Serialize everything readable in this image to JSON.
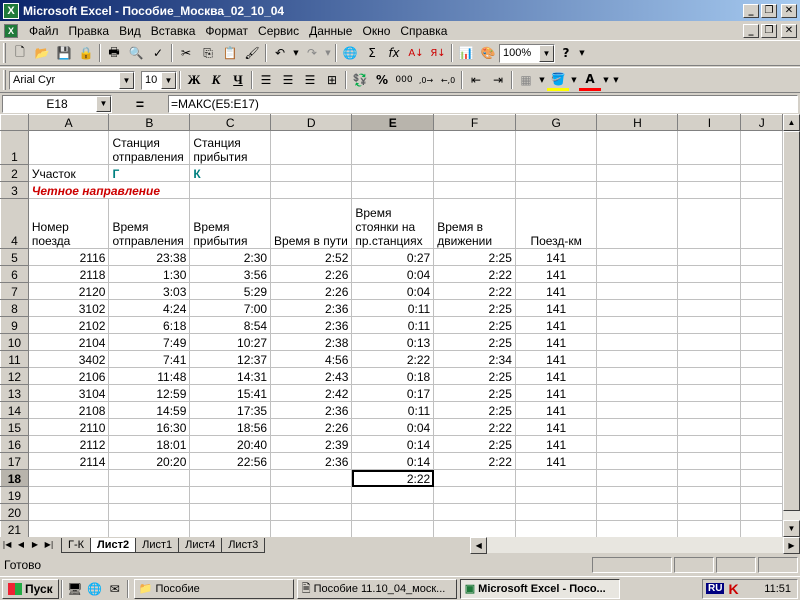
{
  "window": {
    "title": "Microsoft Excel - Пособие_Москва_02_10_04",
    "app_icon_letter": "X"
  },
  "menu": [
    "Файл",
    "Правка",
    "Вид",
    "Вставка",
    "Формат",
    "Сервис",
    "Данные",
    "Окно",
    "Справка"
  ],
  "toolbar": {
    "zoom": "100%",
    "font_name": "Arial Cyr",
    "font_size": "10",
    "bold": "Ж",
    "italic": "К",
    "underline": "Ч"
  },
  "formula_bar": {
    "cell_ref": "E18",
    "equals": "=",
    "formula": "=МАКС(E5:E17)"
  },
  "columns": [
    "A",
    "B",
    "C",
    "D",
    "E",
    "F",
    "G",
    "H",
    "I",
    "J"
  ],
  "cells": {
    "b1": "Станция отправления",
    "c1": "Станция прибытия",
    "a2": "Участок",
    "b2": "Г",
    "c2": "К",
    "a3": "Четное направление",
    "a4": "Номер поезда",
    "b4": "Время отправления",
    "c4": "Время прибытия",
    "d4": "Время в пути",
    "e4": "Время стоянки на пр.станциях",
    "f4": "Время в движении",
    "g4": "Поезд-км",
    "e18": "2:22"
  },
  "rows": [
    [
      "2116",
      "23:38",
      "2:30",
      "2:52",
      "0:27",
      "2:25",
      "141"
    ],
    [
      "2118",
      "1:30",
      "3:56",
      "2:26",
      "0:04",
      "2:22",
      "141"
    ],
    [
      "2120",
      "3:03",
      "5:29",
      "2:26",
      "0:04",
      "2:22",
      "141"
    ],
    [
      "3102",
      "4:24",
      "7:00",
      "2:36",
      "0:11",
      "2:25",
      "141"
    ],
    [
      "2102",
      "6:18",
      "8:54",
      "2:36",
      "0:11",
      "2:25",
      "141"
    ],
    [
      "2104",
      "7:49",
      "10:27",
      "2:38",
      "0:13",
      "2:25",
      "141"
    ],
    [
      "3402",
      "7:41",
      "12:37",
      "4:56",
      "2:22",
      "2:34",
      "141"
    ],
    [
      "2106",
      "11:48",
      "14:31",
      "2:43",
      "0:18",
      "2:25",
      "141"
    ],
    [
      "3104",
      "12:59",
      "15:41",
      "2:42",
      "0:17",
      "2:25",
      "141"
    ],
    [
      "2108",
      "14:59",
      "17:35",
      "2:36",
      "0:11",
      "2:25",
      "141"
    ],
    [
      "2110",
      "16:30",
      "18:56",
      "2:26",
      "0:04",
      "2:22",
      "141"
    ],
    [
      "2112",
      "18:01",
      "20:40",
      "2:39",
      "0:14",
      "2:25",
      "141"
    ],
    [
      "2114",
      "20:20",
      "22:56",
      "2:36",
      "0:14",
      "2:22",
      "141"
    ]
  ],
  "sheet_tabs": [
    "Г-К",
    "Лист2",
    "Лист1",
    "Лист4",
    "Лист3"
  ],
  "active_sheet": "Лист2",
  "status": "Готово",
  "taskbar": {
    "start": "Пуск",
    "tasks": [
      "Пособие",
      "Пособие 11.10_04_моск...",
      "Microsoft Excel - Посо..."
    ],
    "lang": "RU",
    "clock": "11:51"
  }
}
